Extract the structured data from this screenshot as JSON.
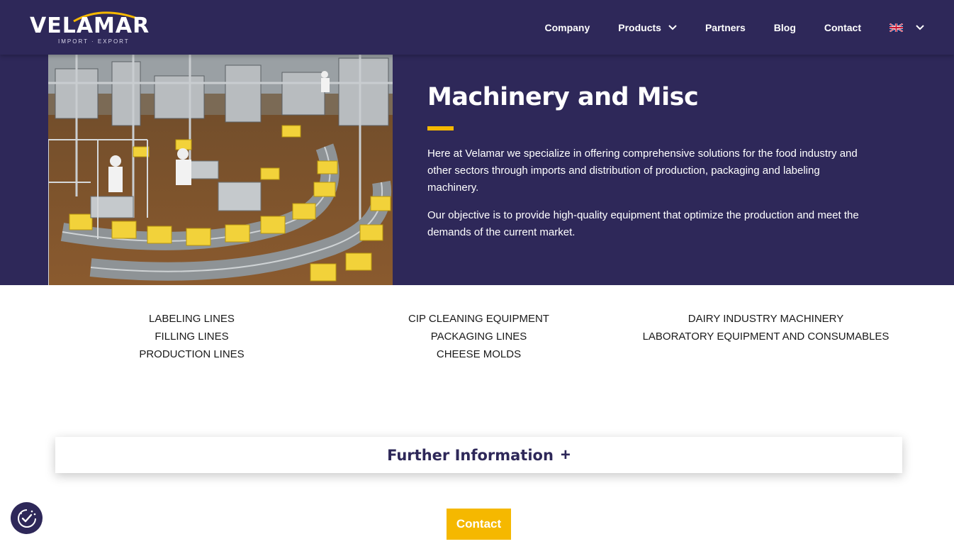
{
  "brand": {
    "name": "VELAMAR",
    "tagline": "IMPORT · EXPORT"
  },
  "nav": {
    "items": [
      {
        "label": "Company"
      },
      {
        "label": "Products"
      },
      {
        "label": "Partners"
      },
      {
        "label": "Blog"
      },
      {
        "label": "Contact"
      }
    ],
    "language_icon": "uk-flag-icon"
  },
  "hero": {
    "title": "Machinery and Misc",
    "paragraph1": "Here at Velamar we specialize in offering comprehensive solutions for the food industry and other sectors through imports and distribution of production, packaging and labeling machinery.",
    "paragraph2": "Our objective is to provide high-quality equipment that optimize the production and meet the demands of the current market."
  },
  "categories": {
    "col1": [
      "LABELING LINES",
      "FILLING LINES",
      "PRODUCTION LINES"
    ],
    "col2": [
      "CIP CLEANING EQUIPMENT",
      "PACKAGING LINES",
      "CHEESE MOLDS"
    ],
    "col3": [
      "DAIRY INDUSTRY MACHINERY",
      "LABORATORY EQUIPMENT AND CONSUMABLES"
    ]
  },
  "further": {
    "label": "Further Information",
    "plus": "+"
  },
  "contact_button": "Contact",
  "colors": {
    "primary": "#2e2859",
    "accent": "#f5b800",
    "text": "#1a1a1a",
    "white": "#ffffff"
  }
}
